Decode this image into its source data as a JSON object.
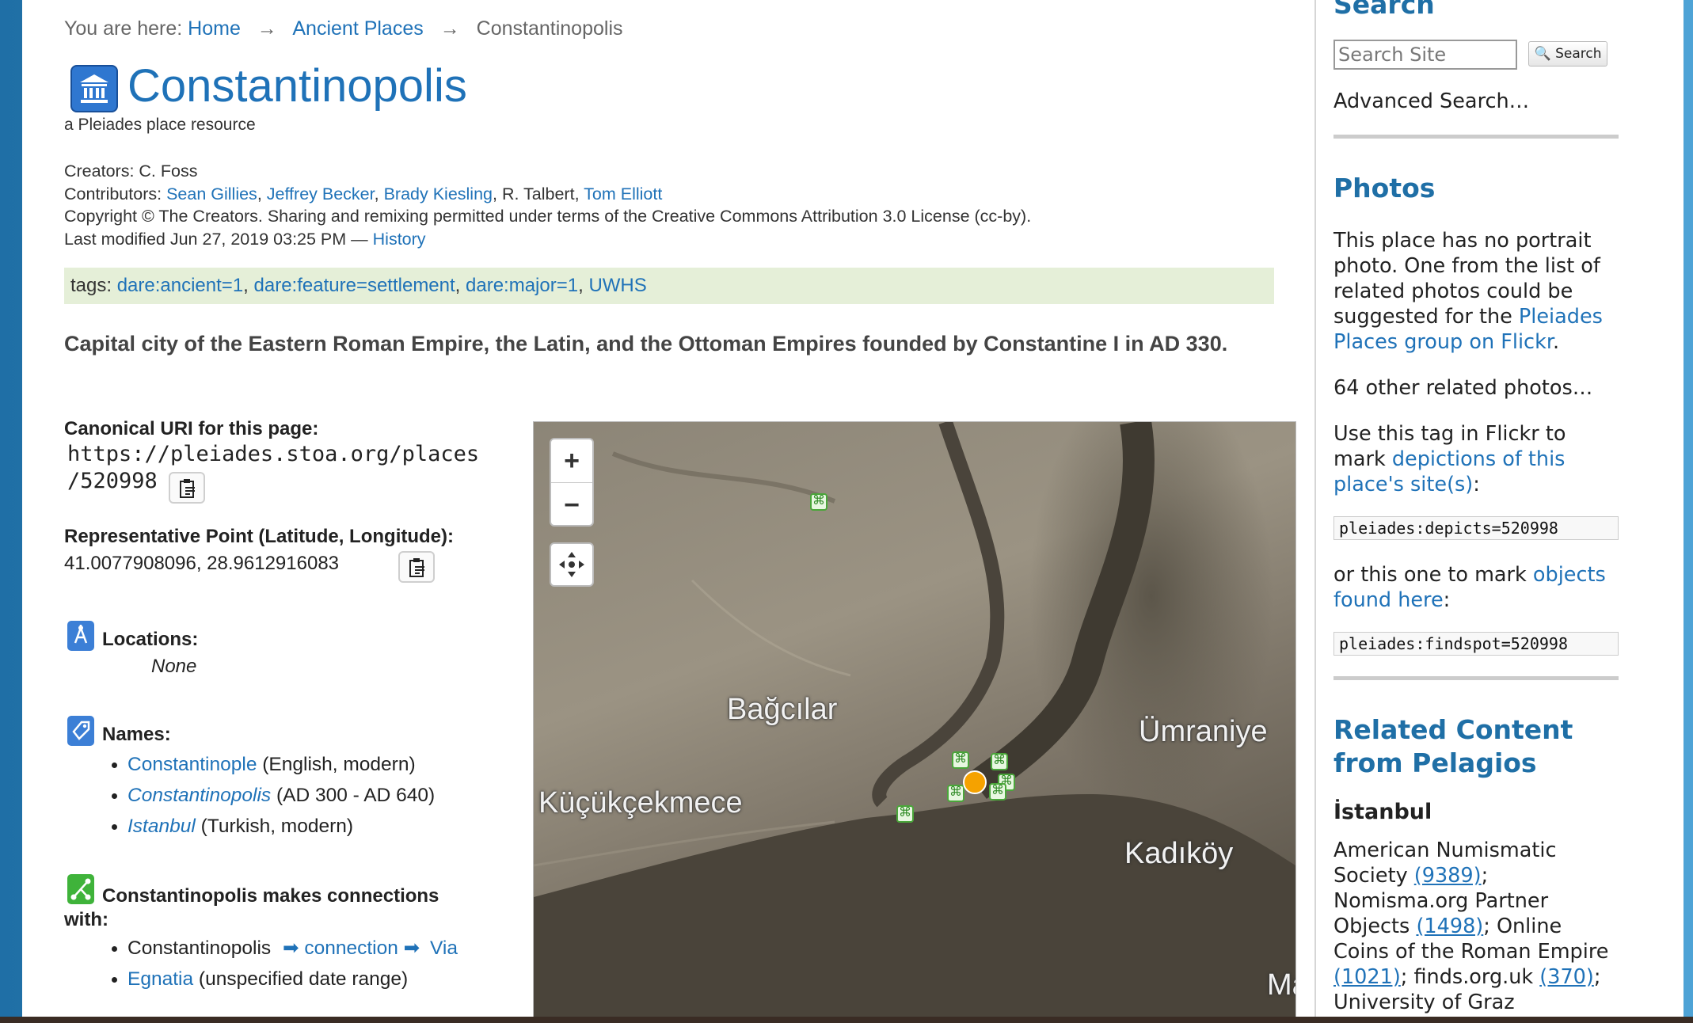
{
  "breadcrumb": {
    "prefix": "You are here:",
    "items": [
      "Home",
      "Ancient Places",
      "Constantinopolis"
    ],
    "separator": "→"
  },
  "page": {
    "title": "Constantinopolis",
    "subtitle": "a Pleiades place resource"
  },
  "meta": {
    "creators_label": "Creators:",
    "creators": "C. Foss",
    "contributors_label": "Contributors:",
    "contributors": [
      "Sean Gillies",
      "Jeffrey Becker",
      "Brady Kiesling",
      "R. Talbert",
      "Tom Elliott"
    ],
    "copyright": "Copyright © The Creators. Sharing and remixing permitted under terms of the Creative Commons Attribution 3.0 License (cc-by).",
    "modified": "Last modified Jun 27, 2019 03:25 PM —",
    "history_link": "History"
  },
  "tags": {
    "label": "tags:",
    "items": [
      "dare:ancient=1",
      "dare:feature=settlement",
      "dare:major=1",
      "UWHS"
    ]
  },
  "description": "Capital city of the Eastern Roman Empire, the Latin, and the Ottoman Empires founded by Constantine I in AD 330.",
  "uri": {
    "label": "Canonical URI for this page:",
    "line1": "https://pleiades.stoa.org/places",
    "line2": "/520998"
  },
  "point": {
    "label": "Representative Point (Latitude, Longitude):",
    "value": "41.0077908096, 28.9612916083"
  },
  "locations": {
    "title": "Locations:",
    "value": "None"
  },
  "names": {
    "title": "Names:",
    "items": [
      {
        "name": "Constantinople",
        "detail": "(English, modern)",
        "italic": false
      },
      {
        "name": "Constantinopolis",
        "detail": "(AD 300 - AD 640)",
        "italic": true
      },
      {
        "name": "Istanbul",
        "detail": "(Turkish, modern)",
        "italic": true
      }
    ]
  },
  "connections": {
    "title": "Constantinopolis makes connections",
    "title2": "with:",
    "from": "Constantinopolis",
    "arrow": "➡",
    "type": "connection",
    "to_line1": "Via",
    "to_line2": "Egnatia",
    "range": "(unspecified date range)"
  },
  "map": {
    "zoom_in": "+",
    "zoom_out": "−",
    "labels": [
      "Bağcılar",
      "Ümraniye",
      "Küçükçekmece",
      "Kadıköy",
      "Ma"
    ]
  },
  "sidebar": {
    "search_heading": "Search",
    "search_placeholder": "Search Site",
    "search_button": "Search",
    "advanced_search": "Advanced Search…",
    "photos_heading": "Photos",
    "photos_text1": "This place has no portrait photo. One from the list of related photos could be suggested for the",
    "photos_link": "Pleiades Places group on Flickr",
    "photos_text1_end": ".",
    "related_photos": "64 other related photos…",
    "tag_text_pre": "Use this tag in Flickr to mark",
    "tag_text_link": "depictions of this place's site(s)",
    "tag_text_end": ":",
    "depicts_tag": "pleiades:depicts=520998",
    "objects_pre": "or this one to mark",
    "objects_link": "objects found here",
    "objects_end": ":",
    "findspot_tag": "pleiades:findspot=520998",
    "related_heading1": "Related Content",
    "related_heading2": "from Pelagios",
    "istanbul": "İstanbul",
    "ans": "American Numismatic Society",
    "ans_count": "(9389)",
    "nomisma": "Nomisma.org Partner Objects",
    "nomisma_count": "(1498)",
    "ocre": "Online Coins of the Roman Empire",
    "ocre_count": "(1021)",
    "finds": "finds.org.uk",
    "finds_count": "(370)",
    "graz": "University of Graz"
  }
}
